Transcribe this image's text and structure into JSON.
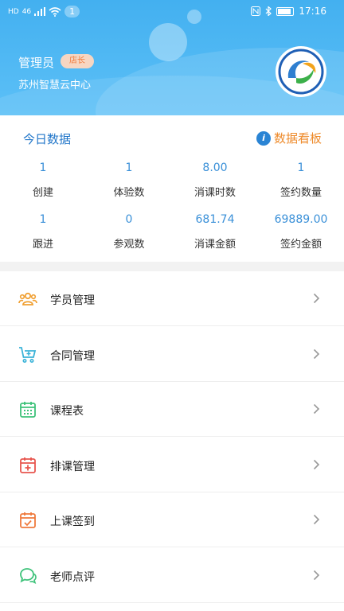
{
  "status_bar": {
    "network": "HD",
    "signal": "46",
    "notification_count": "1",
    "time": "17:16"
  },
  "header": {
    "role": "管理员",
    "role_tag": "店长",
    "org_name": "苏州智慧云中心"
  },
  "today": {
    "title": "今日数据",
    "dashboard_label": "数据看板",
    "stats": [
      {
        "value": "1",
        "label": "创建"
      },
      {
        "value": "1",
        "label": "体验数"
      },
      {
        "value": "8.00",
        "label": "消课时数"
      },
      {
        "value": "1",
        "label": "签约数量"
      },
      {
        "value": "1",
        "label": "跟进"
      },
      {
        "value": "0",
        "label": "参观数"
      },
      {
        "value": "681.74",
        "label": "消课金额"
      },
      {
        "value": "69889.00",
        "label": "签约金额"
      }
    ]
  },
  "menu": {
    "items": [
      {
        "label": "学员管理",
        "icon": "users-icon",
        "color": "#f0a033"
      },
      {
        "label": "合同管理",
        "icon": "cart-icon",
        "color": "#3ab3d8"
      },
      {
        "label": "课程表",
        "icon": "calendar-icon",
        "color": "#3ec27a"
      },
      {
        "label": "排课管理",
        "icon": "calendar-add-icon",
        "color": "#e8554e"
      },
      {
        "label": "上课签到",
        "icon": "calendar-check-icon",
        "color": "#ef7a3c"
      },
      {
        "label": "老师点评",
        "icon": "chat-icon",
        "color": "#3ec27a"
      }
    ]
  },
  "colors": {
    "header_bg": "#4ab5f3",
    "primary_blue": "#2176c9",
    "accent_orange": "#ee8a2a"
  }
}
